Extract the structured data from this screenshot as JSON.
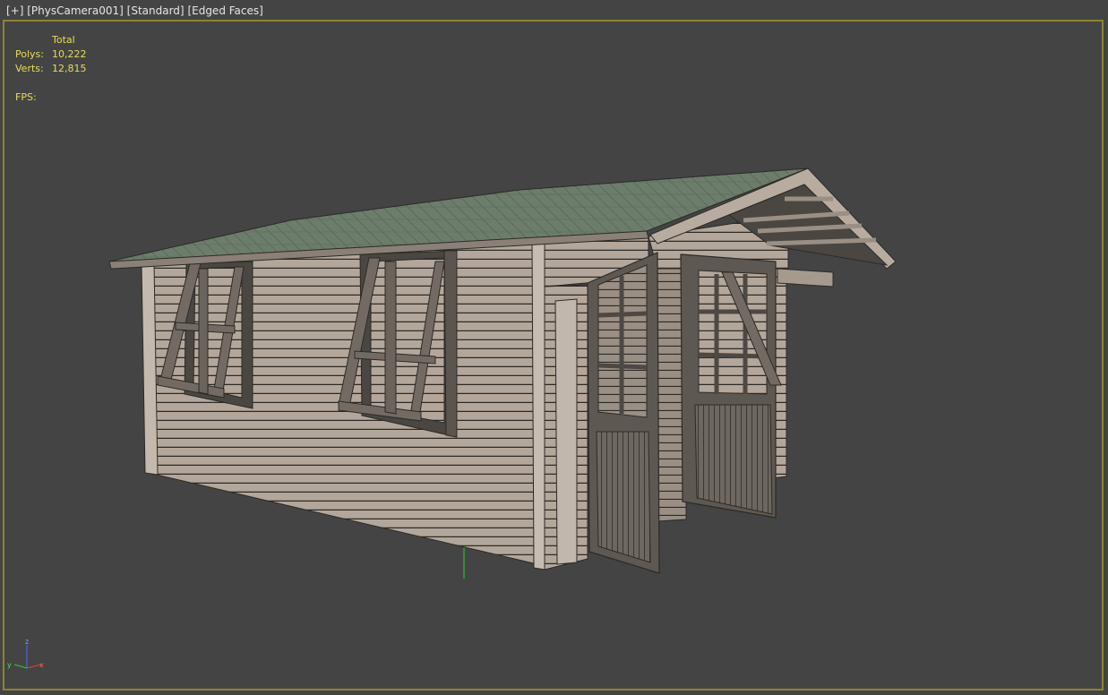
{
  "viewport": {
    "label_parts": [
      "[+]",
      "[PhysCamera001]",
      "[Standard]",
      "[Edged Faces]"
    ]
  },
  "stats": {
    "total_label": "Total",
    "polys_label": "Polys:",
    "polys_value": "10,222",
    "verts_label": "Verts:",
    "verts_value": "12,815",
    "fps_label": "FPS:"
  },
  "gizmo": {
    "x": "x",
    "y": "y",
    "z": "z"
  },
  "colors": {
    "viewport_bg": "#444444",
    "border": "#8c8434",
    "stats_text": "#e8dc5a",
    "wood": "#b0a498",
    "wood_dark": "#6f6860",
    "roof": "#6d7d6c",
    "pivot": "#2ecc40"
  }
}
